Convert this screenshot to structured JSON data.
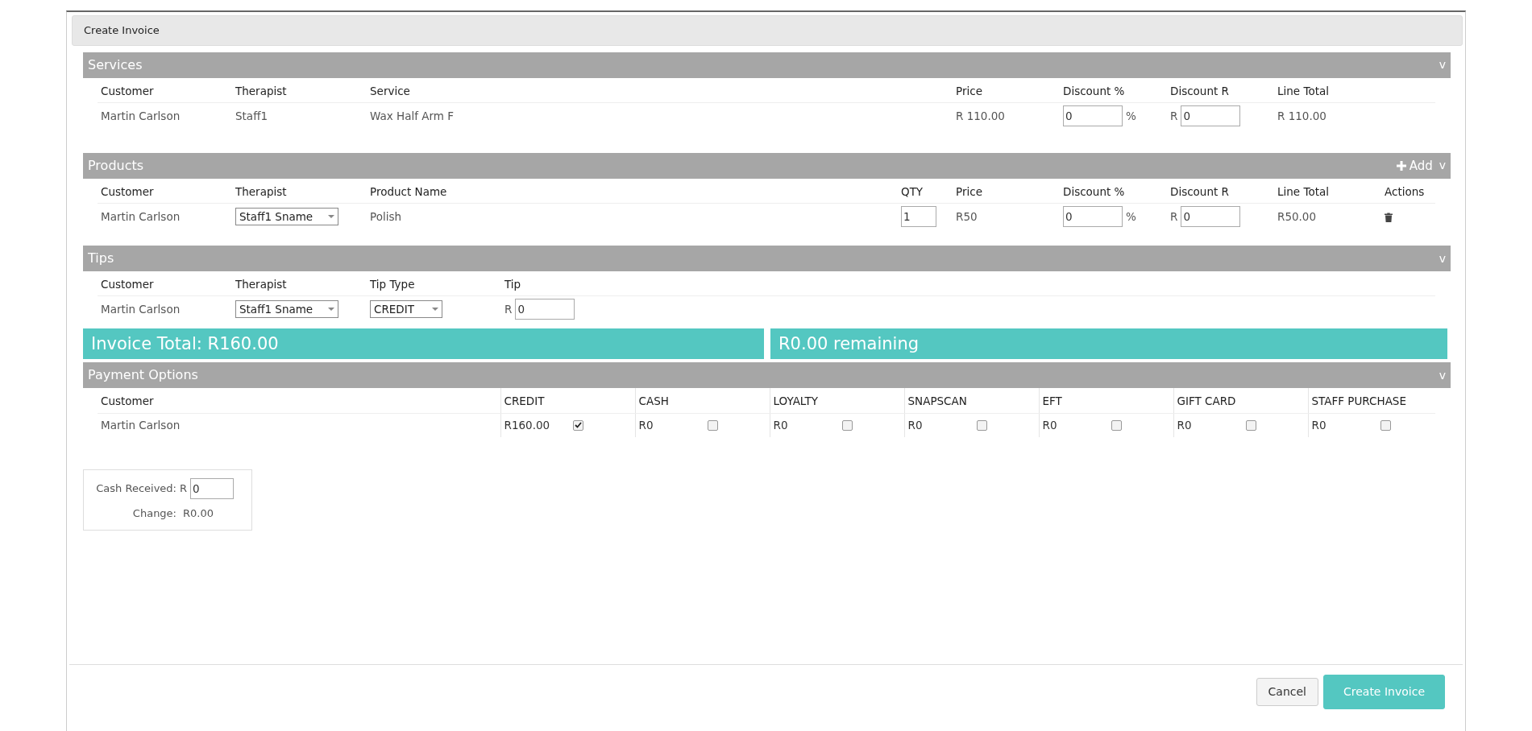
{
  "dialog": {
    "title": "Create Invoice"
  },
  "sections": [
    {
      "title": "Services",
      "toggle": "v",
      "columns": [
        "Customer",
        "Therapist",
        "Service",
        "Price",
        "Discount %",
        "Discount R",
        "Line Total"
      ],
      "rows": [
        {
          "cells": [
            {
              "kind": "text",
              "text": "Martin Carlson"
            },
            {
              "kind": "text",
              "text": "Staff1"
            },
            {
              "kind": "text",
              "text": "Wax Half Arm F"
            },
            {
              "kind": "text",
              "text": "R 110.00"
            },
            {
              "kind": "input",
              "value": "0",
              "suffix": "%"
            },
            {
              "kind": "input",
              "prefix": "R",
              "value": "0"
            },
            {
              "kind": "text",
              "text": "R 110.00"
            }
          ]
        }
      ]
    },
    {
      "title": "Products",
      "add_label": "Add",
      "toggle": "v",
      "columns": [
        "Customer",
        "Therapist",
        "Product Name",
        "QTY",
        "Price",
        "Discount %",
        "Discount R",
        "Line Total",
        "Actions"
      ],
      "rows": [
        {
          "cells": [
            {
              "kind": "text",
              "text": "Martin Carlson"
            },
            {
              "kind": "select",
              "value": "Staff1 Sname"
            },
            {
              "kind": "text",
              "text": "Polish"
            },
            {
              "kind": "input",
              "value": "1"
            },
            {
              "kind": "text",
              "text": "R50"
            },
            {
              "kind": "input",
              "value": "0",
              "suffix": "%"
            },
            {
              "kind": "input",
              "prefix": "R",
              "value": "0"
            },
            {
              "kind": "text",
              "text": "R50.00"
            },
            {
              "kind": "delete"
            }
          ]
        }
      ]
    },
    {
      "title": "Tips",
      "toggle": "v",
      "columns": [
        "Customer",
        "Therapist",
        "Tip Type",
        "Tip"
      ],
      "rows": [
        {
          "cells": [
            {
              "kind": "text",
              "text": "Martin Carlson"
            },
            {
              "kind": "select",
              "value": "Staff1 Sname"
            },
            {
              "kind": "select",
              "value": "CREDIT"
            },
            {
              "kind": "input",
              "prefix": "R",
              "value": "0"
            }
          ]
        }
      ]
    }
  ],
  "totals": {
    "invoice_total": "Invoice Total: R160.00",
    "remaining": "R0.00 remaining"
  },
  "payment": {
    "title": "Payment Options",
    "toggle": "v",
    "customer_column": "Customer",
    "methods": [
      "CREDIT",
      "CASH",
      "LOYALTY",
      "SNAPSCAN",
      "EFT",
      "GIFT CARD",
      "STAFF PURCHASE"
    ],
    "rows": [
      {
        "customer": "Martin Carlson",
        "amounts": [
          {
            "amount": "R160.00",
            "checked": true
          },
          {
            "amount": "R0",
            "checked": false
          },
          {
            "amount": "R0",
            "checked": false
          },
          {
            "amount": "R0",
            "checked": false
          },
          {
            "amount": "R0",
            "checked": false
          },
          {
            "amount": "R0",
            "checked": false
          },
          {
            "amount": "R0",
            "checked": false
          }
        ]
      }
    ]
  },
  "cash": {
    "received_label": "Cash Received:",
    "received_prefix": "R",
    "received_value": "0",
    "change_label": "Change:",
    "change_value": "R0.00"
  },
  "buttons": [
    {
      "kind": "secondary",
      "label": "Cancel"
    },
    {
      "kind": "primary",
      "label": "Create Invoice"
    }
  ]
}
